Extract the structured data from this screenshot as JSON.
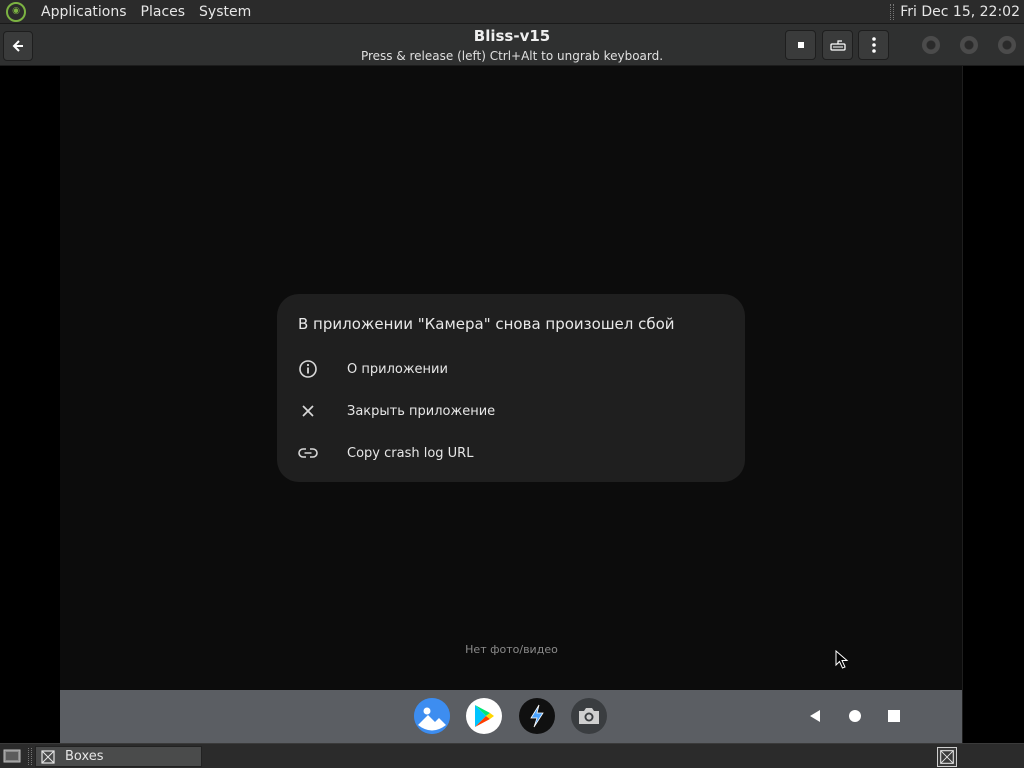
{
  "top_panel": {
    "menus": [
      "Applications",
      "Places",
      "System"
    ],
    "clock": "Fri Dec 15, 22:02",
    "logo_icon": "linux-mint-logo-icon"
  },
  "header_bar": {
    "title": "Bliss-v15",
    "subtitle": "Press & release (left) Ctrl+Alt to ungrab keyboard.",
    "buttons": [
      "back-arrow-icon",
      "stop-icon",
      "keyboard-icon",
      "kebab-menu-icon"
    ]
  },
  "vm": {
    "crash_dialog": {
      "title": "В приложении \"Камера\" снова произошел сбой",
      "options": [
        {
          "icon": "info-icon",
          "label": "О приложении"
        },
        {
          "icon": "close-icon",
          "label": "Закрыть приложение"
        },
        {
          "icon": "link-icon",
          "label": "Copy crash log URL"
        }
      ]
    },
    "empty_message": "Нет фото/видео",
    "dock_apps": [
      "gallery-icon",
      "play-store-icon",
      "lightning-browser-icon",
      "camera-icon"
    ],
    "nav_buttons": [
      "back-triangle-icon",
      "home-circle-icon",
      "recents-square-icon"
    ]
  },
  "taskbar": {
    "task_label": "Boxes"
  },
  "colors": {
    "panel_bg": "#2b2b2b",
    "headerbar_bg": "#2f3030",
    "vm_bg": "#0c0c0c",
    "dialog_bg": "#1f1f1f",
    "nav_bar_bg": "#5b5e63",
    "mint_green": "#7cb342"
  }
}
